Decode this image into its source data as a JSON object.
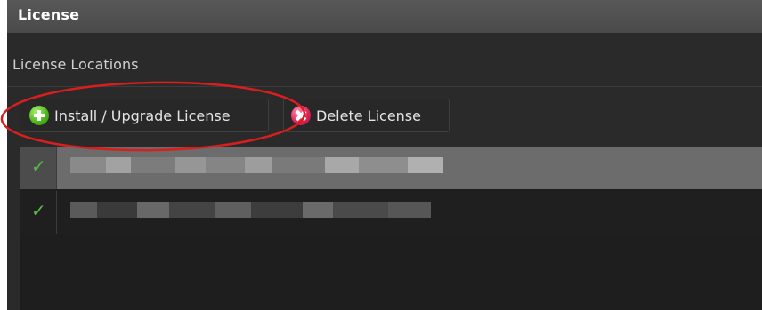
{
  "window": {
    "title": "License"
  },
  "section": {
    "title": "License Locations"
  },
  "toolbar": {
    "install_label": "Install / Upgrade License",
    "install_icon": "add-circle-icon",
    "delete_label": "Delete License",
    "delete_icon": "remove-circle-icon"
  },
  "licenses": [
    {
      "status": "valid",
      "path_fragment": "...cnewz...",
      "selected": true
    },
    {
      "status": "valid",
      "path_fragment": "C:/",
      "selected": false
    }
  ],
  "colors": {
    "panel_bg": "#2a2a2a",
    "title_bg": "#4f4f4f",
    "selected_row": "#6c6c6c",
    "check_green": "#59b84a",
    "annotation_red": "#d81e1e"
  }
}
